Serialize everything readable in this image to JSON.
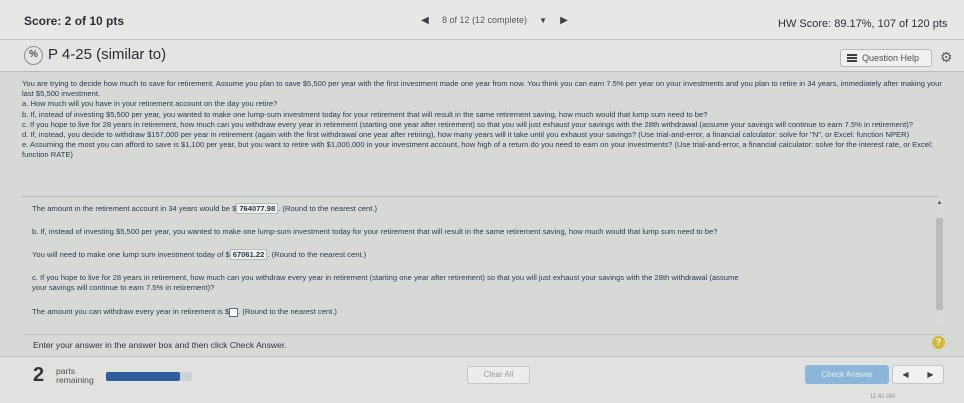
{
  "topbar": {
    "score": "Score: 2 of 10 pts",
    "position": "8 of 12 (12 complete)",
    "hw_score": "HW Score: 89.17%, 107 of 120 pts"
  },
  "question": {
    "title": "P 4-25 (similar to)",
    "help_label": "Question Help"
  },
  "problem": {
    "paragraphs": [
      "You are trying to decide how much to save for retirement. Assume you plan to save $5,500 per year with the first investment made one year from now. You think you can earn 7.5% per year on your investments and you plan to retire in  34 years, immediately after making your last $5,500 investment.",
      "a. How much will you have in your retirement account on the day you retire?",
      "b. If, instead of investing $5,500 per year, you wanted to make one lump-sum investment today for your retirement that will result in the same retirement saving, how much would that lump sum need to be?",
      "c. If you hope to live for 28 years in retirement, how much can you withdraw every year in retirement (starting one year after retirement) so that you will just exhaust your savings with the 28th withdrawal (assume your savings will continue to earn 7.5% in retirement)?",
      "d. If, instead, you decide to withdraw $157,000 per year in retirement (again with the first withdrawal one year after retiring), how many years will it take until you exhaust your savings? (Use trial-and-error, a financial calculator: solve for \"N\", or Excel: function NPER)",
      "e. Assuming the most you can afford to save is $1,100 per year, but you want to retire with $1,000,000 in your investment account, how high of a return do you need to earn on your investments? (Use trial-and-error, a financial calculator: solve for the interest rate, or Excel: function RATE)"
    ]
  },
  "answers": {
    "a_prefix": "The amount in the retirement account in 34 years would be $",
    "a_value": "764077.98",
    "a_suffix": ". (Round to the nearest cent.)",
    "b_question": "b. If, instead of investing $5,500 per year, you wanted to make one lump-sum investment today for your retirement that will result in the same retirement saving, how much would that lump sum need to be?",
    "b_prefix": "You will need to make one lump sum investment today of $",
    "b_value": "67061.22",
    "b_suffix": ". (Round to the nearest cent.)",
    "c_question_1": "c. If you hope to live for 28 years in retirement, how much can you withdraw every year in retirement (starting one year after retirement) so that you will just exhaust your savings with the 28th withdrawal (assume",
    "c_question_2": "your savings will continue to earn 7.5% in retirement)?",
    "c_prefix": "The amount you can withdraw every year in retirement is $",
    "c_suffix": ". (Round to the nearest cent.)"
  },
  "footer": {
    "instructions": "Enter your answer in the answer box and then click Check Answer.",
    "help_mark": "?",
    "parts_number": "2",
    "parts_label_1": "parts",
    "parts_label_2": "remaining",
    "progress_fraction": 0.86,
    "clear_all": "Clear All",
    "check_answer": "Check Answer",
    "clock": "11:41 AM"
  }
}
